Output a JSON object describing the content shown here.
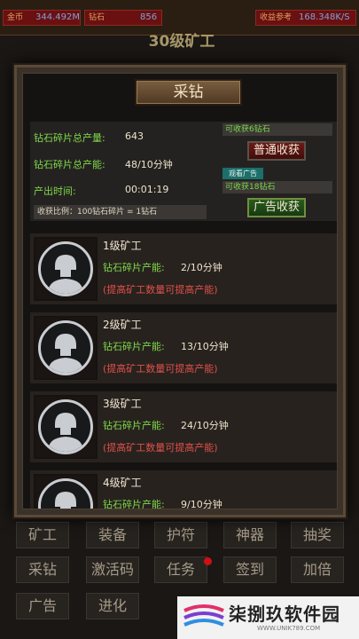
{
  "topbar": {
    "gold_label": "金币",
    "gold_value": "344.492M",
    "diamond_label": "钻石",
    "diamond_value": "856",
    "income_label": "收益参考",
    "income_value": "168.348K/S"
  },
  "background_title": "30级矿工",
  "nav": {
    "row1": [
      "矿工",
      "装备",
      "护符",
      "神器",
      "抽奖"
    ],
    "row2": [
      "采钻",
      "激活码",
      "任务",
      "签到",
      "加倍"
    ],
    "row3": [
      "广告",
      "进化"
    ]
  },
  "dialog": {
    "title": "采钻",
    "summary": {
      "total_output_label": "钻石碎片总产量:",
      "total_output_value": "643",
      "total_capacity_label": "钻石碎片总产能:",
      "total_capacity_value": "48/10分钟",
      "time_label": "产出时间:",
      "time_value": "00:01:19",
      "ratio_text": "收获比例：100钻石碎片 = 1钻石"
    },
    "normal_harvest": {
      "note": "可收获6钻石",
      "button": "普通收获"
    },
    "ad_harvest": {
      "tag": "观看广告",
      "note": "可收获18钻石",
      "button": "广告收获"
    },
    "workers": [
      {
        "name": "1级矿工",
        "rate_label": "钻石碎片产能:",
        "rate_value": "2/10分钟",
        "hint": "(提高矿工数量可提高产能)"
      },
      {
        "name": "2级矿工",
        "rate_label": "钻石碎片产能:",
        "rate_value": "13/10分钟",
        "hint": "(提高矿工数量可提高产能)"
      },
      {
        "name": "3级矿工",
        "rate_label": "钻石碎片产能:",
        "rate_value": "24/10分钟",
        "hint": "(提高矿工数量可提高产能)"
      },
      {
        "name": "4级矿工",
        "rate_label": "钻石碎片产能:",
        "rate_value": "9/10分钟",
        "hint": ""
      }
    ]
  },
  "watermark": {
    "text": "柒捌玖软件园",
    "url": "WWW.UNIK789.COM"
  }
}
